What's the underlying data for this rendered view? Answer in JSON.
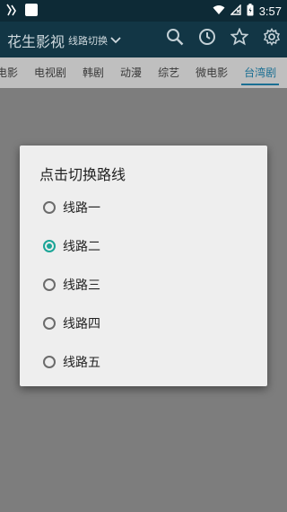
{
  "status_bar": {
    "time": "3:57"
  },
  "app_bar": {
    "title": "花生影视",
    "route_switch_label": "线路切换"
  },
  "tabs": [
    {
      "label": "电影",
      "active": false
    },
    {
      "label": "电视剧",
      "active": false
    },
    {
      "label": "韩剧",
      "active": false
    },
    {
      "label": "动漫",
      "active": false
    },
    {
      "label": "综艺",
      "active": false
    },
    {
      "label": "微电影",
      "active": false
    },
    {
      "label": "台湾剧",
      "active": true
    }
  ],
  "dialog": {
    "title": "点击切换路线",
    "options": [
      {
        "label": "线路一",
        "checked": false
      },
      {
        "label": "线路二",
        "checked": true
      },
      {
        "label": "线路三",
        "checked": false
      },
      {
        "label": "线路四",
        "checked": false
      },
      {
        "label": "线路五",
        "checked": false
      }
    ]
  },
  "colors": {
    "status_bar_bg": "#0d2a36",
    "app_bar_bg": "#123645",
    "accent": "#1ba597",
    "tab_active": "#1b6f93"
  }
}
